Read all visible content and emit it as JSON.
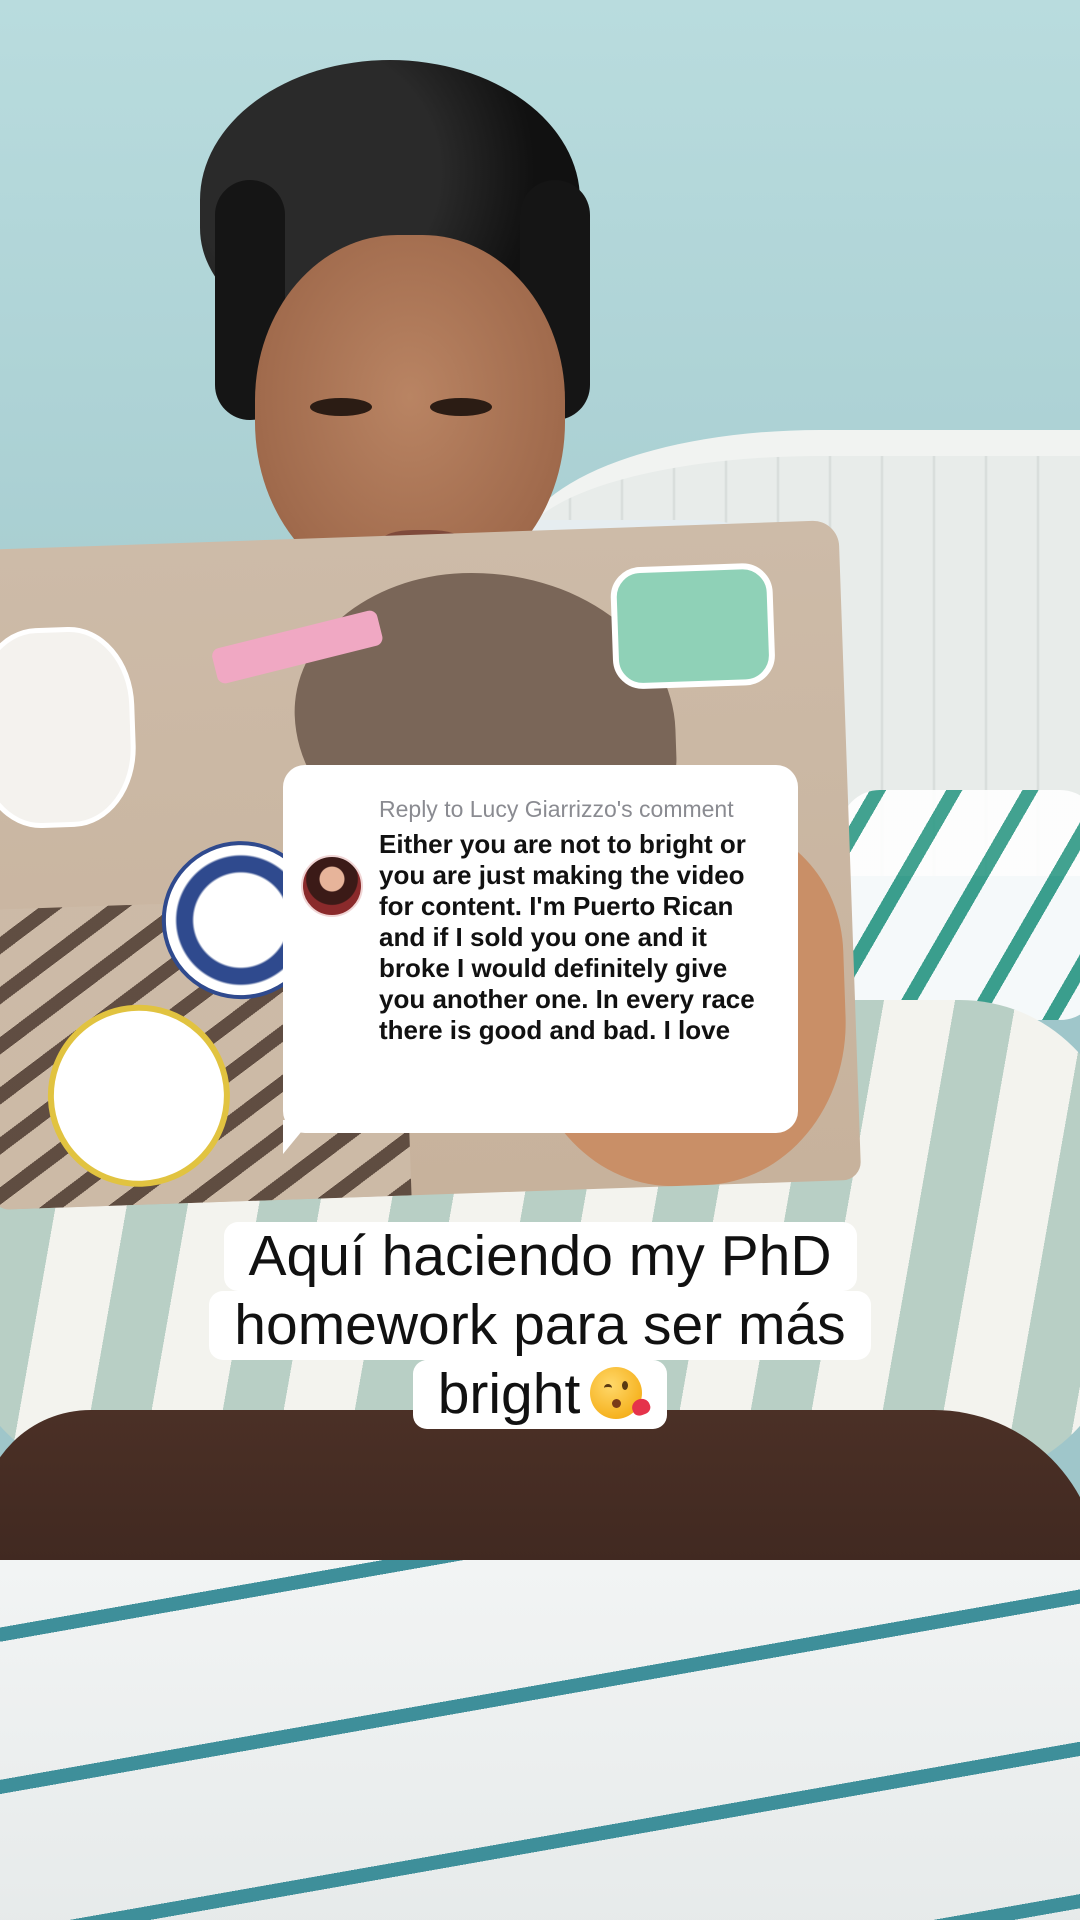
{
  "reply_card": {
    "header": "Reply to Lucy Giarrizzo's comment",
    "avatar_icon": "commenter-avatar",
    "comment_text": "Either you are not to bright or you are just making the video for content. I'm Puerto Rican and if I sold you one and it broke I would definitely give you another one. In every race there is good and bad. I love"
  },
  "caption": {
    "line1": "Aquí haciendo my PhD",
    "line2": "homework para ser más",
    "line3": "bright",
    "emoji": "kissing-face-with-heart-emoji"
  },
  "colors": {
    "card_background": "#ffffff",
    "header_text": "#8a8b91",
    "body_text": "#111111"
  }
}
